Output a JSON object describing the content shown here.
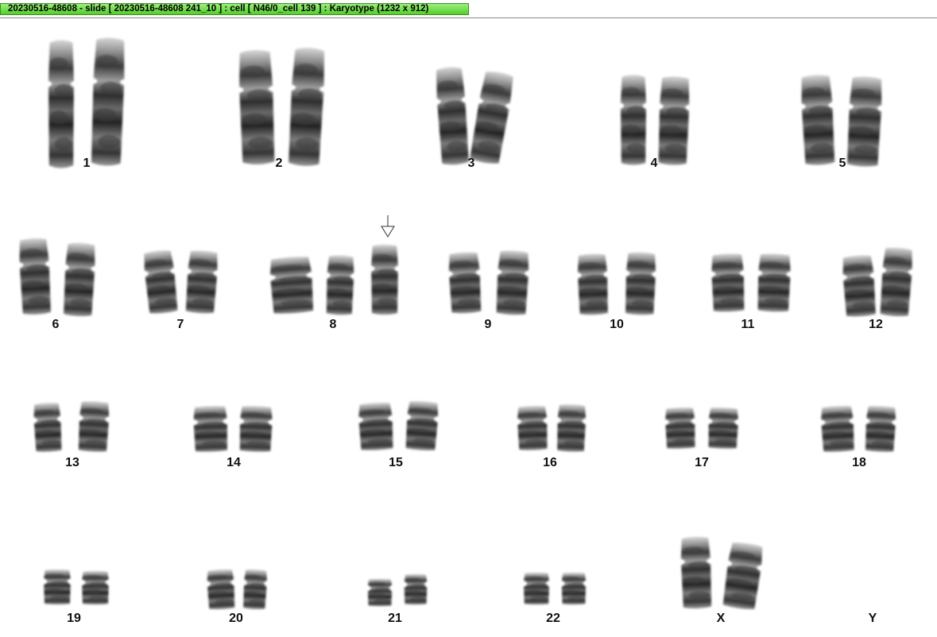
{
  "window": {
    "title": "20230516-48608 - slide [ 20230516-48608 241_10 ] : cell [ N46/0_cell 139 ] : Karyotype  (1232 x 912)",
    "title_color": "#5fd43a"
  },
  "karyotype": {
    "labels": {
      "c1": "1",
      "c2": "2",
      "c3": "3",
      "c4": "4",
      "c5": "5",
      "c6": "6",
      "c7": "7",
      "c8": "8",
      "c9": "9",
      "c10": "10",
      "c11": "11",
      "c12": "12",
      "c13": "13",
      "c14": "14",
      "c15": "15",
      "c16": "16",
      "c17": "17",
      "c18": "18",
      "c19": "19",
      "c20": "20",
      "c21": "21",
      "c22": "22",
      "cX": "X",
      "cY": "Y"
    },
    "annotation_icon": "down-arrow-icon",
    "annotated_chromosome": "8",
    "chromosome_shading": "#3a3a3a"
  }
}
